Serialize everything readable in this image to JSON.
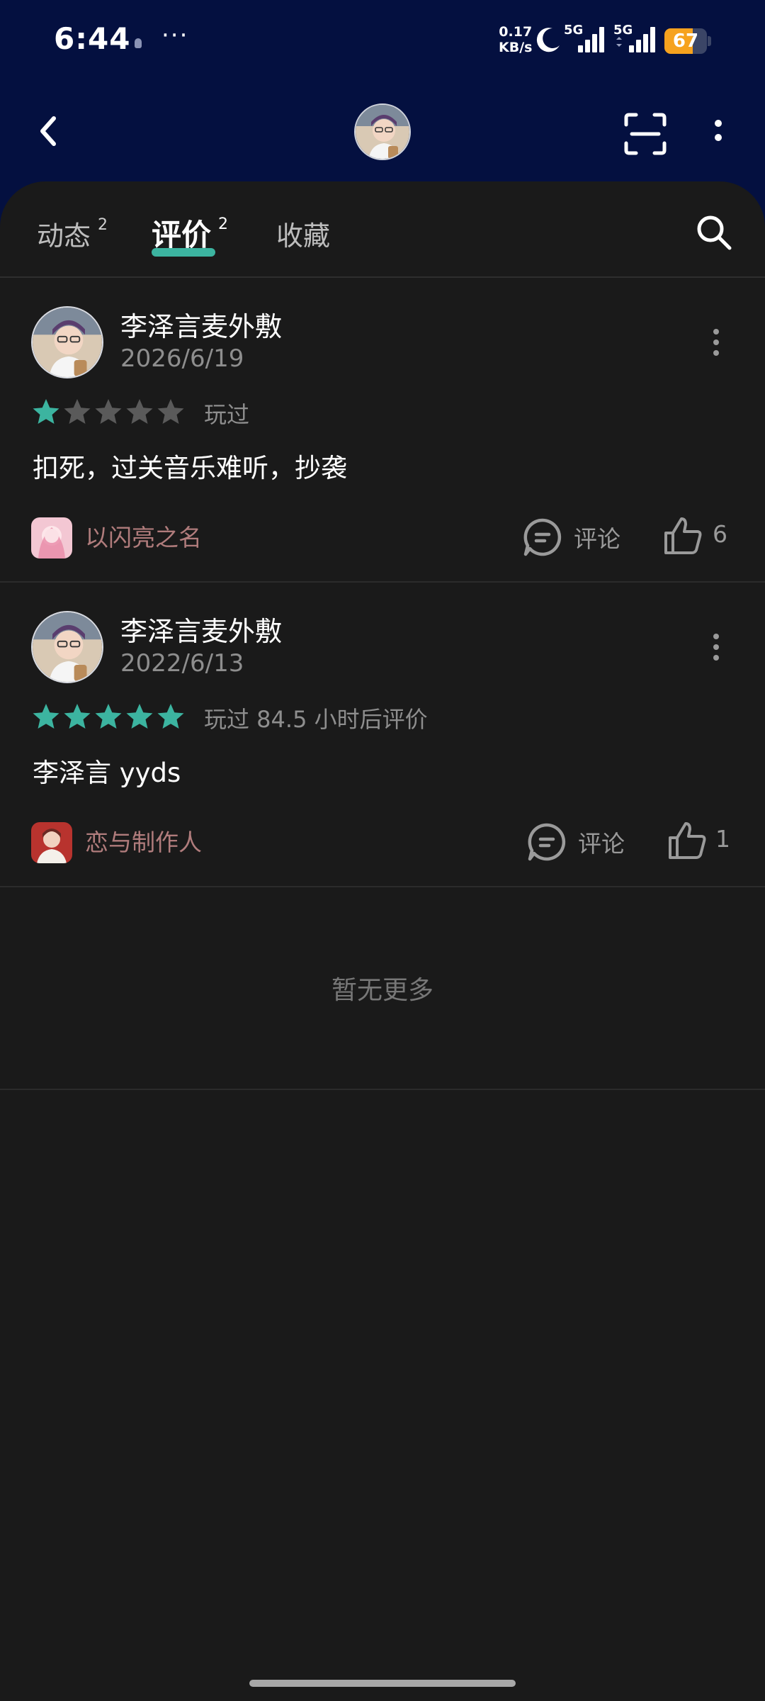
{
  "status_bar": {
    "time": "6:44",
    "more": "···",
    "net_speed_value": "0.17",
    "net_speed_unit": "KB/s",
    "sim1": "5G",
    "sim2": "5G",
    "battery": "67",
    "battery_level": 0.67
  },
  "navbar": {
    "back_icon": "chevron-left-icon",
    "scan_icon": "scan-icon",
    "menu_icon": "more-vertical-icon"
  },
  "tabs": [
    {
      "label": "动态",
      "count": "2"
    },
    {
      "label": "评价",
      "count": "2",
      "active": true
    },
    {
      "label": "收藏"
    }
  ],
  "reviews": [
    {
      "username": "李泽言麦外敷",
      "date": "2026/6/19",
      "rating": 1,
      "played": "玩过",
      "text": "扣死，过关音乐难听，抄袭",
      "game": "以闪亮之名",
      "comment_label": "评论",
      "likes": "6"
    },
    {
      "username": "李泽言麦外敷",
      "date": "2022/6/13",
      "rating": 5,
      "played": "玩过 84.5 小时后评价",
      "text": "李泽言 yyds",
      "game": "恋与制作人",
      "comment_label": "评论",
      "likes": "1"
    }
  ],
  "footer": {
    "no_more": "暂无更多"
  },
  "colors": {
    "header_bg": "#041040",
    "sheet_bg": "#1a1a1a",
    "accent": "#3cb4a0",
    "star_filled": "#3cb4a0",
    "star_empty": "#5a5a5a",
    "game_name": "#b07c7c",
    "battery": "#f6a21e"
  }
}
